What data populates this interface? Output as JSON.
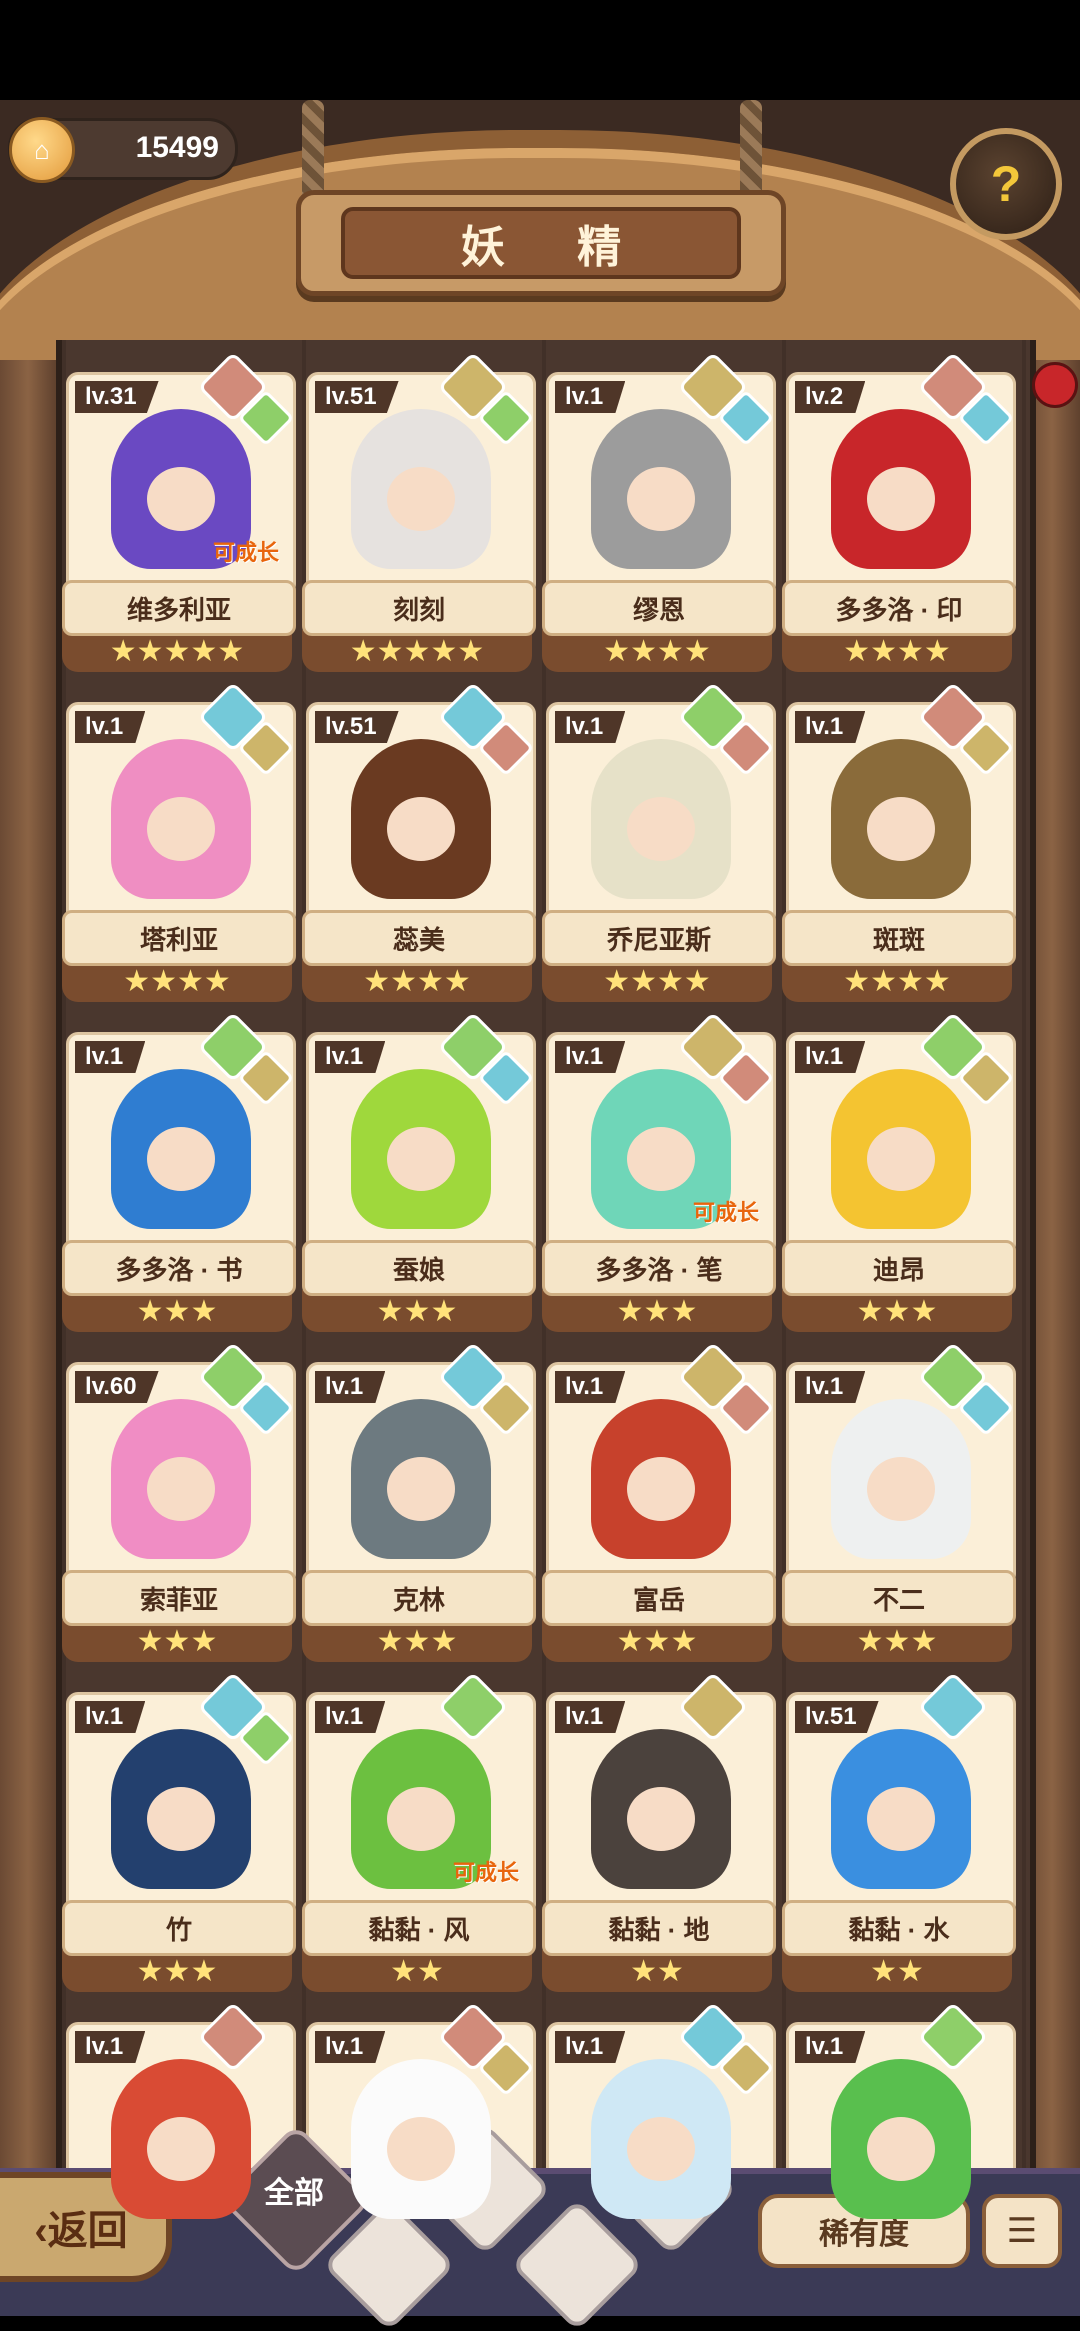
{
  "currency": {
    "value": "15499",
    "icon": "house-coin-icon"
  },
  "title": "妖 精",
  "help": {
    "icon": "question-sprout-icon",
    "label": "?"
  },
  "cards": [
    {
      "lv": "lv.31",
      "name": "维多利亚",
      "stars": "★★★★★",
      "growth": "可成长",
      "c": "#6a49c2",
      "g1": "#d18b7a",
      "g2": "#8ecf69"
    },
    {
      "lv": "lv.51",
      "name": "刻刻",
      "stars": "★★★★★",
      "growth": "",
      "c": "#e6e2df",
      "g1": "#cdb56a",
      "g2": "#8ecf69"
    },
    {
      "lv": "lv.1",
      "name": "缪恩",
      "stars": "★★★★",
      "growth": "",
      "c": "#9c9c9c",
      "g1": "#cdb56a",
      "g2": "#74c9d9"
    },
    {
      "lv": "lv.2",
      "name": "多多洛 · 印",
      "stars": "★★★★",
      "growth": "",
      "c": "#c8262a",
      "g1": "#d18b7a",
      "g2": "#74c9d9"
    },
    {
      "lv": "lv.1",
      "name": "塔利亚",
      "stars": "★★★★",
      "growth": "",
      "c": "#ef8ec2",
      "g1": "#74c9d9",
      "g2": "#cdb56a"
    },
    {
      "lv": "lv.51",
      "name": "蕊美",
      "stars": "★★★★",
      "growth": "",
      "c": "#6a3a21",
      "g1": "#74c9d9",
      "g2": "#d18b7a"
    },
    {
      "lv": "lv.1",
      "name": "乔尼亚斯",
      "stars": "★★★★",
      "growth": "",
      "c": "#e6e1c8",
      "g1": "#8ecf69",
      "g2": "#d18b7a"
    },
    {
      "lv": "lv.1",
      "name": "斑斑",
      "stars": "★★★★",
      "growth": "",
      "c": "#8a6b3a",
      "g1": "#d18b7a",
      "g2": "#cdb56a"
    },
    {
      "lv": "lv.1",
      "name": "多多洛 · 书",
      "stars": "★★★",
      "growth": "",
      "c": "#2f7dd1",
      "g1": "#8ecf69",
      "g2": "#cdb56a"
    },
    {
      "lv": "lv.1",
      "name": "蚕娘",
      "stars": "★★★",
      "growth": "",
      "c": "#9fd83c",
      "g1": "#8ecf69",
      "g2": "#74c9d9"
    },
    {
      "lv": "lv.1",
      "name": "多多洛 · 笔",
      "stars": "★★★",
      "growth": "可成长",
      "c": "#6fd6b8",
      "g1": "#cdb56a",
      "g2": "#d18b7a"
    },
    {
      "lv": "lv.1",
      "name": "迪昂",
      "stars": "★★★",
      "growth": "",
      "c": "#f4c431",
      "g1": "#8ecf69",
      "g2": "#cdb56a"
    },
    {
      "lv": "lv.60",
      "name": "索菲亚",
      "stars": "★★★",
      "growth": "",
      "c": "#f08dc4",
      "g1": "#8ecf69",
      "g2": "#74c9d9"
    },
    {
      "lv": "lv.1",
      "name": "克林",
      "stars": "★★★",
      "growth": "",
      "c": "#6d7a80",
      "g1": "#74c9d9",
      "g2": "#cdb56a"
    },
    {
      "lv": "lv.1",
      "name": "富岳",
      "stars": "★★★",
      "growth": "",
      "c": "#c7412c",
      "g1": "#cdb56a",
      "g2": "#d18b7a"
    },
    {
      "lv": "lv.1",
      "name": "不二",
      "stars": "★★★",
      "growth": "",
      "c": "#eef0f0",
      "g1": "#8ecf69",
      "g2": "#74c9d9"
    },
    {
      "lv": "lv.1",
      "name": "竹",
      "stars": "★★★",
      "growth": "",
      "c": "#23406e",
      "g1": "#74c9d9",
      "g2": "#8ecf69"
    },
    {
      "lv": "lv.1",
      "name": "黏黏 · 风",
      "stars": "★★",
      "growth": "可成长",
      "c": "#6cc040",
      "g1": "#8ecf69",
      "g2": ""
    },
    {
      "lv": "lv.1",
      "name": "黏黏 · 地",
      "stars": "★★",
      "growth": "",
      "c": "#4b423d",
      "g1": "#cdb56a",
      "g2": ""
    },
    {
      "lv": "lv.51",
      "name": "黏黏 · 水",
      "stars": "★★",
      "growth": "",
      "c": "#3a8fe0",
      "g1": "#74c9d9",
      "g2": ""
    },
    {
      "lv": "lv.1",
      "name": "",
      "stars": "",
      "growth": "",
      "c": "#d94b34",
      "g1": "#d18b7a",
      "g2": ""
    },
    {
      "lv": "lv.1",
      "name": "",
      "stars": "",
      "growth": "",
      "c": "#fbfbfb",
      "g1": "#d18b7a",
      "g2": "#cdb56a"
    },
    {
      "lv": "lv.1",
      "name": "",
      "stars": "",
      "growth": "",
      "c": "#cfe8f5",
      "g1": "#74c9d9",
      "g2": "#cdb56a"
    },
    {
      "lv": "lv.1",
      "name": "",
      "stars": "",
      "growth": "",
      "c": "#59bf4e",
      "g1": "#8ecf69",
      "g2": ""
    }
  ],
  "bottom": {
    "back": "‹返回",
    "all": "全部",
    "rarity": "稀有度",
    "sort_icon": "sort-list-icon"
  }
}
